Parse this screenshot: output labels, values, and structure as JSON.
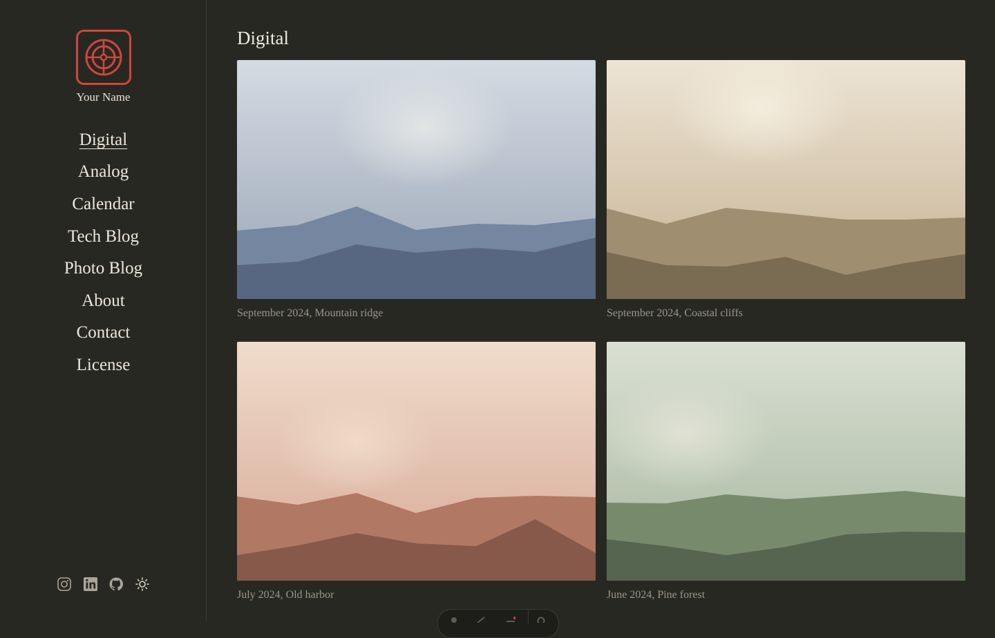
{
  "site": {
    "name": "Your Name",
    "logo_icon": "aperture-icon",
    "accent": "#d0463d"
  },
  "nav": {
    "items": [
      {
        "label": "Digital",
        "active": true
      },
      {
        "label": "Analog"
      },
      {
        "label": "Calendar"
      },
      {
        "label": "Tech Blog"
      },
      {
        "label": "Photo Blog"
      },
      {
        "label": "About"
      },
      {
        "label": "Contact"
      },
      {
        "label": "License"
      }
    ]
  },
  "socials": [
    "instagram-icon",
    "linkedin-icon",
    "github-icon",
    "sun-icon"
  ],
  "main": {
    "title": "Digital",
    "photos": [
      {
        "caption": "September 2024, Mountain ridge",
        "palette": [
          "#d3dbe3",
          "#9aa5b5",
          "#7586a0",
          "#586781"
        ]
      },
      {
        "caption": "September 2024, Coastal cliffs",
        "palette": [
          "#ede4d4",
          "#c4b091",
          "#a08e70",
          "#7a6c52"
        ]
      },
      {
        "caption": "July 2024, Old harbor",
        "palette": [
          "#efdccb",
          "#d8a896",
          "#b17864",
          "#87594a"
        ]
      },
      {
        "caption": "June 2024, Pine forest",
        "palette": [
          "#dae0d3",
          "#a5b69e",
          "#788a6c",
          "#556550"
        ]
      }
    ]
  }
}
